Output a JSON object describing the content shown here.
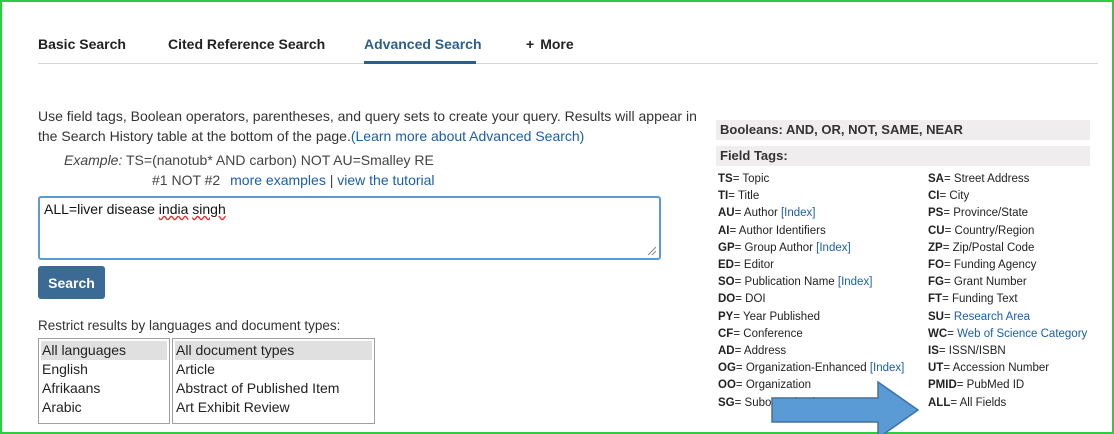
{
  "tabs": [
    {
      "label": "Basic Search"
    },
    {
      "label": "Cited Reference Search"
    },
    {
      "label": "Advanced Search"
    },
    {
      "label": "More"
    }
  ],
  "intro": {
    "text": "Use field tags, Boolean operators, parentheses, and query sets to create your query. Results will appear in the Search History table at the bottom of the page.",
    "link": "(Learn more about Advanced Search)"
  },
  "example": {
    "label": "Example:",
    "query": "TS=(nanotub* AND carbon) NOT AU=Smalley RE",
    "query2": "#1 NOT #2",
    "more_examples": "more examples",
    "separator": "|",
    "tutorial": "view the tutorial"
  },
  "query": {
    "prefix": "ALL=liver disease ",
    "word1": "india",
    "space": " ",
    "word2": "singh"
  },
  "search_button": "Search",
  "restrict_label": "Restrict results by languages and document types:",
  "languages": [
    "All languages",
    "English",
    "Afrikaans",
    "Arabic"
  ],
  "doc_types": [
    "All document types",
    "Article",
    "Abstract of Published Item",
    "Art Exhibit Review"
  ],
  "right_panel": {
    "booleans": "Booleans: AND, OR, NOT, SAME, NEAR",
    "field_tags_title": "Field Tags:",
    "col1": [
      {
        "tag": "TS",
        "desc": "Topic",
        "index": ""
      },
      {
        "tag": "TI",
        "desc": "Title",
        "index": ""
      },
      {
        "tag": "AU",
        "desc": "Author ",
        "index": "[Index]"
      },
      {
        "tag": "AI",
        "desc": "Author Identifiers",
        "index": ""
      },
      {
        "tag": "GP",
        "desc": "Group Author ",
        "index": "[Index]"
      },
      {
        "tag": "ED",
        "desc": "Editor",
        "index": ""
      },
      {
        "tag": "SO",
        "desc": "Publication Name ",
        "index": "[Index]"
      },
      {
        "tag": "DO",
        "desc": "DOI",
        "index": ""
      },
      {
        "tag": "PY",
        "desc": "Year Published",
        "index": ""
      },
      {
        "tag": "CF",
        "desc": "Conference",
        "index": ""
      },
      {
        "tag": "AD",
        "desc": "Address",
        "index": ""
      },
      {
        "tag": "OG",
        "desc": "Organization-Enhanced ",
        "index": "[Index]"
      },
      {
        "tag": "OO",
        "desc": "Organization",
        "index": ""
      },
      {
        "tag": "SG",
        "desc": "Suborganization",
        "index": ""
      }
    ],
    "col2": [
      {
        "tag": "SA",
        "desc": "Street Address",
        "link": false
      },
      {
        "tag": "CI",
        "desc": "City",
        "link": false
      },
      {
        "tag": "PS",
        "desc": "Province/State",
        "link": false
      },
      {
        "tag": "CU",
        "desc": "Country/Region",
        "link": false
      },
      {
        "tag": "ZP",
        "desc": "Zip/Postal Code",
        "link": false
      },
      {
        "tag": "FO",
        "desc": "Funding Agency",
        "link": false
      },
      {
        "tag": "FG",
        "desc": "Grant Number",
        "link": false
      },
      {
        "tag": "FT",
        "desc": "Funding Text",
        "link": false
      },
      {
        "tag": "SU",
        "desc": "Research Area",
        "link": true
      },
      {
        "tag": "WC",
        "desc": "Web of Science Category",
        "link": true
      },
      {
        "tag": "IS",
        "desc": "ISSN/ISBN",
        "link": false
      },
      {
        "tag": "UT",
        "desc": "Accession Number",
        "link": false
      },
      {
        "tag": "PMID",
        "desc": "PubMed ID",
        "link": false
      },
      {
        "tag": "ALL",
        "desc": "All Fields",
        "link": false
      }
    ]
  },
  "colors": {
    "accent": "#2c5f8a",
    "button": "#3b6a94",
    "link": "#1b5ea8",
    "frame": "#2ecc40",
    "arrow": "#5b9bd5"
  }
}
